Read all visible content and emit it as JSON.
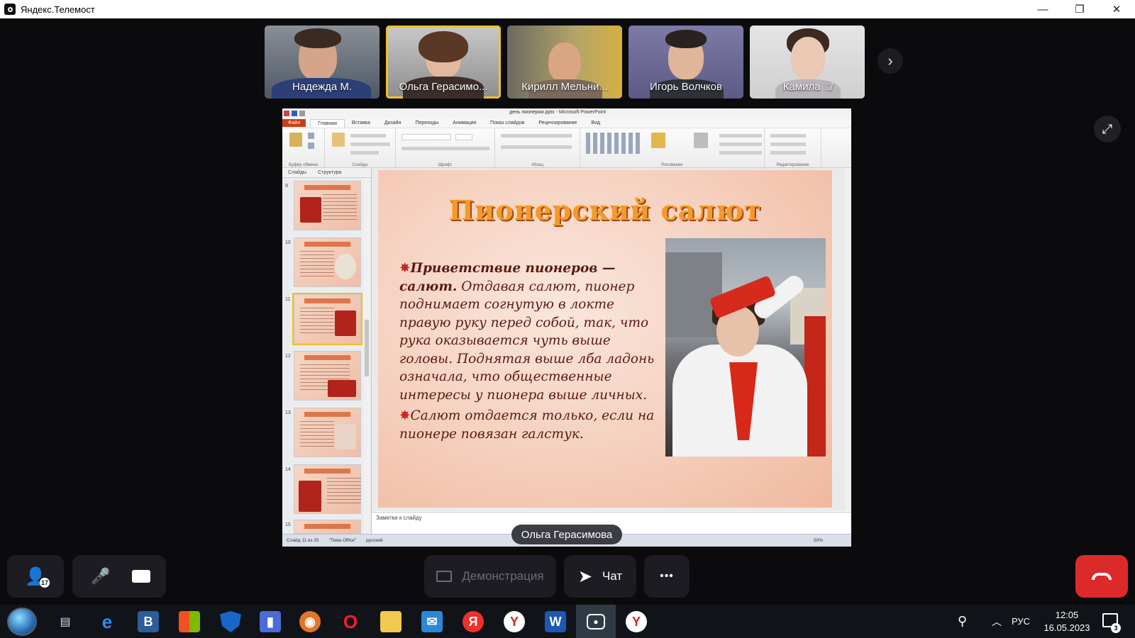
{
  "window": {
    "title": "Яндекс.Телемост",
    "minimize_glyph": "—",
    "restore_glyph": "❐",
    "close_glyph": "✕"
  },
  "participants": [
    {
      "name": "Надежда М.",
      "active": false,
      "mic_muted": false
    },
    {
      "name": "Ольга Герасимо...",
      "active": true,
      "mic_muted": false
    },
    {
      "name": "Кирилл Мельни...",
      "active": false,
      "mic_muted": false
    },
    {
      "name": "Игорь Волчков",
      "active": false,
      "mic_muted": false
    },
    {
      "name": "Камила",
      "active": false,
      "mic_muted": true
    }
  ],
  "participants_next_glyph": "›",
  "fullscreen_glyph": "⤢",
  "shared_screen": {
    "document_title": "день пионерии.pptx - Microsoft PowerPoint",
    "file_tab": "Файл",
    "tabs": [
      "Главная",
      "Вставка",
      "Дизайн",
      "Переходы",
      "Анимация",
      "Показ слайдов",
      "Рецензирование",
      "Вид"
    ],
    "ribbon_groups": [
      "Буфер обмена",
      "Слайды",
      "Шрифт",
      "Абзац",
      "Рисование",
      "Редактирование"
    ],
    "left_tabs": [
      "Слайды",
      "Структура"
    ],
    "thumbnail_numbers": [
      "9",
      "10",
      "11",
      "12",
      "13",
      "14",
      "15"
    ],
    "current_slide": 11,
    "slide": {
      "title": "Пионерский салют",
      "bullet1_bold": "Приветствие пионеров — салют.",
      "bullet1_rest": "Отдавая салют, пионер поднимает согнутую в локте правую руку перед собой, так, что рука оказывается чуть выше головы. Поднятая выше лба ладонь означала, что общественные интересы у пионера выше личных.",
      "bullet2": "Салют отдается только, если на пионере повязан галстук."
    },
    "notes_placeholder": "Заметки к слайду",
    "status_slide": "Слайд 11 из 25",
    "status_theme": "\"Тема Office\"",
    "status_lang": "русский",
    "status_zoom": "50%"
  },
  "speaker_label": "Ольга Герасимова",
  "controls": {
    "invite_badge": "17",
    "demo_label": "Демонстрация",
    "chat_label": "Чат",
    "more_glyph": "•••"
  },
  "taskbar": {
    "apps": [
      "task-view",
      "edge",
      "vk",
      "store",
      "defender",
      "zoom",
      "photos",
      "opera",
      "files",
      "mail",
      "yandex",
      "yandex-browser",
      "word",
      "telemost",
      "yandex-browser-2"
    ],
    "lang": "РУС",
    "time": "12:05",
    "date": "16.05.2023",
    "notifications": "3"
  },
  "colors": {
    "accent_active": "#f3c21f",
    "hangup": "#dc2a2a",
    "slide_title": "#f29a2e"
  }
}
